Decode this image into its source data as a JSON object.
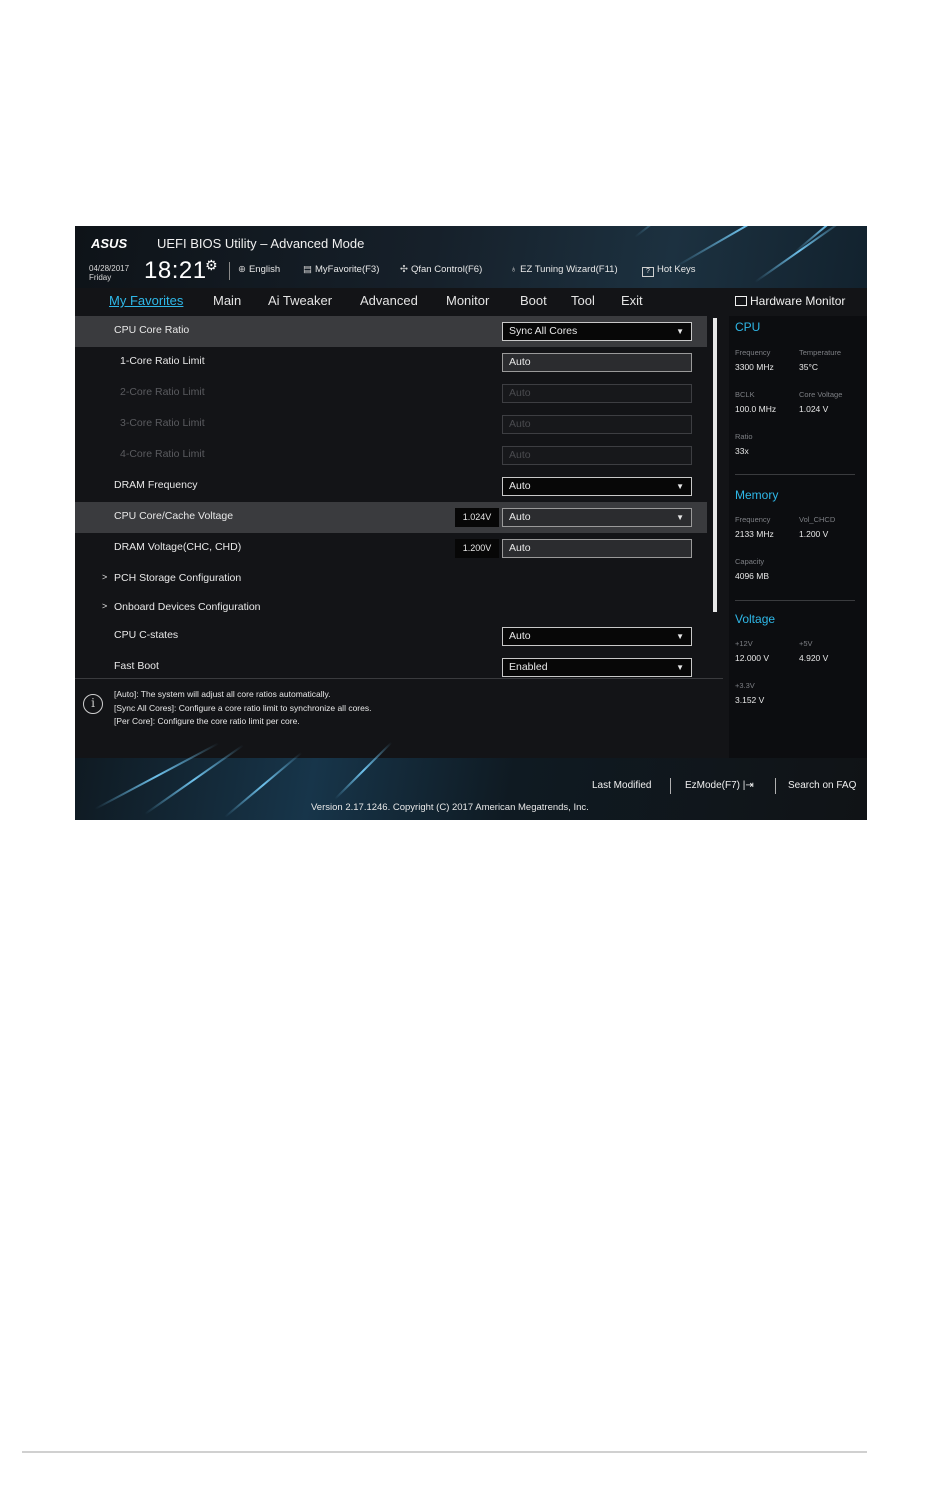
{
  "header": {
    "logo": "ASUS",
    "title": "UEFI BIOS Utility – Advanced Mode",
    "date": "04/28/2017",
    "day": "Friday",
    "time": "18:21",
    "tools": [
      {
        "label": "English",
        "icon": "globe-icon"
      },
      {
        "label": "MyFavorite(F3)",
        "icon": "favorite-list-icon"
      },
      {
        "label": "Qfan Control(F6)",
        "icon": "fan-icon"
      },
      {
        "label": "EZ Tuning Wizard(F11)",
        "icon": "bulb-icon"
      },
      {
        "label": "Hot Keys",
        "icon": "question-icon"
      }
    ]
  },
  "menu": {
    "items": [
      "My Favorites",
      "Main",
      "Ai Tweaker",
      "Advanced",
      "Monitor",
      "Boot",
      "Tool",
      "Exit"
    ],
    "active": "My Favorites"
  },
  "settings": [
    {
      "label": "CPU Core Ratio",
      "value": "Sync All Cores",
      "type": "dropdown",
      "highlighted": true
    },
    {
      "label": "1-Core Ratio Limit",
      "value": "Auto",
      "type": "field"
    },
    {
      "label": "2-Core Ratio Limit",
      "value": "Auto",
      "type": "field",
      "disabled": true
    },
    {
      "label": "3-Core Ratio Limit",
      "value": "Auto",
      "type": "field",
      "disabled": true
    },
    {
      "label": "4-Core Ratio Limit",
      "value": "Auto",
      "type": "field",
      "disabled": true
    },
    {
      "label": "DRAM Frequency",
      "value": "Auto",
      "type": "dropdown"
    },
    {
      "label": "CPU Core/Cache Voltage",
      "value": "Auto",
      "type": "dropdown",
      "reading": "1.024V",
      "highlighted": true
    },
    {
      "label": "DRAM Voltage(CHC, CHD)",
      "value": "Auto",
      "type": "field",
      "reading": "1.200V"
    },
    {
      "label": "PCH Storage Configuration",
      "type": "submenu"
    },
    {
      "label": "Onboard Devices Configuration",
      "type": "submenu"
    },
    {
      "label": "CPU C-states",
      "value": "Auto",
      "type": "dropdown"
    },
    {
      "label": "Fast Boot",
      "value": "Enabled",
      "type": "dropdown"
    }
  ],
  "help": {
    "lines": [
      "[Auto]: The system will adjust all core ratios automatically.",
      "[Sync All Cores]: Configure a core ratio limit to synchronize all cores.",
      "[Per Core]: Configure the core ratio limit per core."
    ]
  },
  "hardware_monitor": {
    "title": "Hardware Monitor",
    "cpu": {
      "heading": "CPU",
      "frequency_label": "Frequency",
      "frequency": "3300 MHz",
      "temperature_label": "Temperature",
      "temperature": "35°C",
      "bclk_label": "BCLK",
      "bclk": "100.0 MHz",
      "core_voltage_label": "Core Voltage",
      "core_voltage": "1.024 V",
      "ratio_label": "Ratio",
      "ratio": "33x"
    },
    "memory": {
      "heading": "Memory",
      "frequency_label": "Frequency",
      "frequency": "2133 MHz",
      "vol_label": "Vol_CHCD",
      "vol": "1.200 V",
      "capacity_label": "Capacity",
      "capacity": "4096 MB"
    },
    "voltage": {
      "heading": "Voltage",
      "v12_label": "+12V",
      "v12": "12.000 V",
      "v5_label": "+5V",
      "v5": "4.920 V",
      "v33_label": "+3.3V",
      "v33": "3.152 V"
    }
  },
  "bottom": {
    "last_modified": "Last Modified",
    "ezmode": "EzMode(F7)",
    "search": "Search on FAQ",
    "copyright": "Version 2.17.1246. Copyright (C) 2017 American Megatrends, Inc."
  },
  "colors": {
    "accent": "#2fb8e8",
    "background": "#131417",
    "highlight_row": "#3a3b3e"
  }
}
